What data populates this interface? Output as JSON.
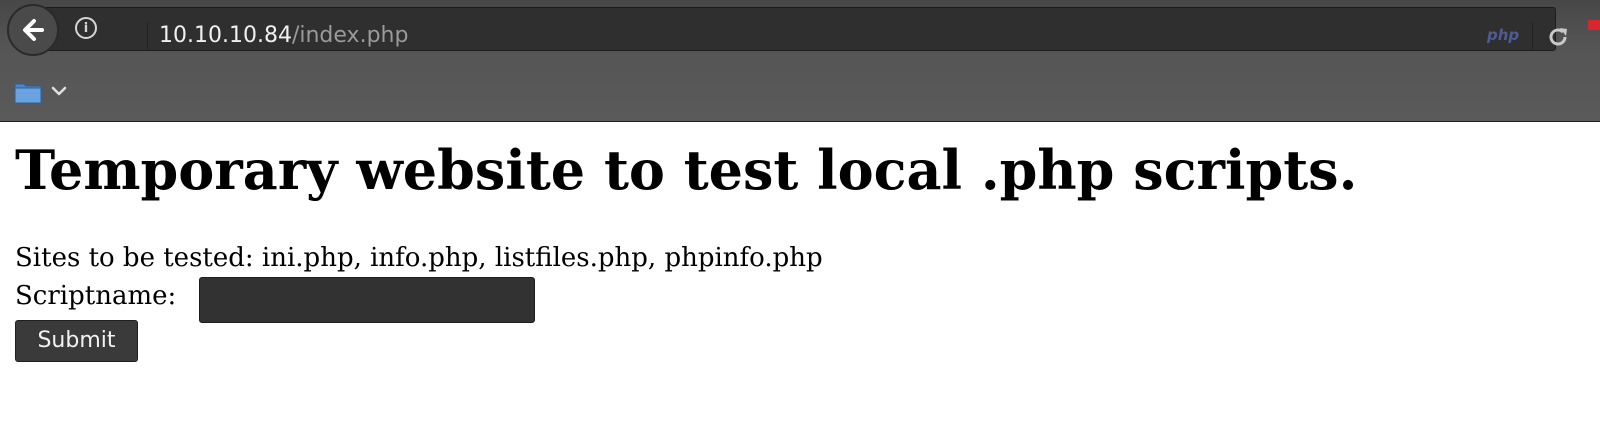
{
  "browser": {
    "url_host": "10.10.10.84",
    "url_path": "/index.php",
    "page_badge": "php",
    "icons": [
      "back-arrow-icon",
      "info-icon",
      "reload-icon",
      "flag-icon",
      "folder-icon",
      "chevron-down-icon"
    ]
  },
  "page": {
    "heading": "Temporary website to test local .php scripts.",
    "sites_text": "Sites to be tested: ini.php, info.php, listfiles.php, phpinfo.php",
    "form": {
      "label": "Scriptname:",
      "input_value": "",
      "submit_label": "Submit"
    }
  },
  "colors": {
    "toolbar": "#555555",
    "urlbar": "#2f2f2f",
    "php_badge": "#4f5b93",
    "button": "#3a3a3a"
  }
}
